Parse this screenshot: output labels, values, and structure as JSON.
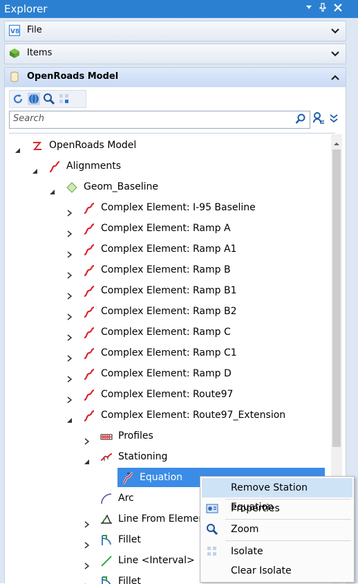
{
  "window": {
    "title": "Explorer"
  },
  "sections": {
    "file": {
      "label": "File"
    },
    "items": {
      "label": "Items"
    },
    "model": {
      "label": "OpenRoads Model"
    }
  },
  "search": {
    "placeholder": "Search"
  },
  "tree": {
    "root": "OpenRoads Model",
    "alignments": "Alignments",
    "geom": "Geom_Baseline",
    "complex": [
      "Complex Element: I-95 Baseline",
      "Complex Element: Ramp A",
      "Complex Element: Ramp A1",
      "Complex Element: Ramp B",
      "Complex Element: Ramp B1",
      "Complex Element: Ramp B2",
      "Complex Element: Ramp C",
      "Complex Element: Ramp C1",
      "Complex Element: Ramp D",
      "Complex Element: Route97",
      "Complex Element: Route97_Extension"
    ],
    "profiles": "Profiles",
    "stationing": "Stationing",
    "equation": "Equation",
    "arc": "Arc",
    "line_from_element": "Line From Element",
    "fillet": "Fillet",
    "line_interval": "Line <Interval>",
    "fillet2": "Fillet"
  },
  "context_menu": {
    "remove": "Remove Station Equation",
    "properties": "Properties",
    "zoom": "Zoom",
    "isolate": "Isolate",
    "clear_isolate": "Clear Isolate"
  },
  "colors": {
    "titlebar": "#2b80d1",
    "selection": "#3b8ce6",
    "alignment_red": "#d9272e"
  }
}
